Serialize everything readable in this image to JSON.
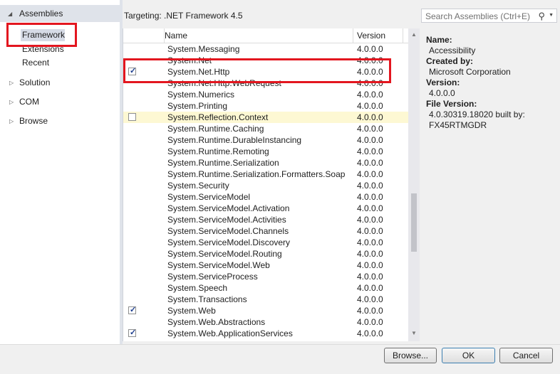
{
  "sidebar": {
    "header": "Assemblies",
    "items": [
      {
        "label": "Framework",
        "selected": true
      },
      {
        "label": "Extensions"
      },
      {
        "label": "Recent"
      }
    ],
    "groups": [
      "Solution",
      "COM",
      "Browse"
    ]
  },
  "targeting": "Targeting: .NET Framework 4.5",
  "search": {
    "placeholder": "Search Assemblies (Ctrl+E)"
  },
  "grid": {
    "columns": {
      "name": "Name",
      "version": "Version"
    },
    "rows": [
      {
        "name": "System.Messaging",
        "version": "4.0.0.0",
        "checkbox": false,
        "checked": false
      },
      {
        "name": "System.Net",
        "version": "4.0.0.0",
        "checkbox": false,
        "checked": false
      },
      {
        "name": "System.Net.Http",
        "version": "4.0.0.0",
        "checkbox": true,
        "checked": true
      },
      {
        "name": "System.Net.Http.WebRequest",
        "version": "4.0.0.0",
        "checkbox": false,
        "checked": false
      },
      {
        "name": "System.Numerics",
        "version": "4.0.0.0",
        "checkbox": false,
        "checked": false
      },
      {
        "name": "System.Printing",
        "version": "4.0.0.0",
        "checkbox": false,
        "checked": false
      },
      {
        "name": "System.Reflection.Context",
        "version": "4.0.0.0",
        "checkbox": true,
        "checked": false,
        "highlighted": true
      },
      {
        "name": "System.Runtime.Caching",
        "version": "4.0.0.0",
        "checkbox": false,
        "checked": false
      },
      {
        "name": "System.Runtime.DurableInstancing",
        "version": "4.0.0.0",
        "checkbox": false,
        "checked": false
      },
      {
        "name": "System.Runtime.Remoting",
        "version": "4.0.0.0",
        "checkbox": false,
        "checked": false
      },
      {
        "name": "System.Runtime.Serialization",
        "version": "4.0.0.0",
        "checkbox": false,
        "checked": false
      },
      {
        "name": "System.Runtime.Serialization.Formatters.Soap",
        "version": "4.0.0.0",
        "checkbox": false,
        "checked": false
      },
      {
        "name": "System.Security",
        "version": "4.0.0.0",
        "checkbox": false,
        "checked": false
      },
      {
        "name": "System.ServiceModel",
        "version": "4.0.0.0",
        "checkbox": false,
        "checked": false
      },
      {
        "name": "System.ServiceModel.Activation",
        "version": "4.0.0.0",
        "checkbox": false,
        "checked": false
      },
      {
        "name": "System.ServiceModel.Activities",
        "version": "4.0.0.0",
        "checkbox": false,
        "checked": false
      },
      {
        "name": "System.ServiceModel.Channels",
        "version": "4.0.0.0",
        "checkbox": false,
        "checked": false
      },
      {
        "name": "System.ServiceModel.Discovery",
        "version": "4.0.0.0",
        "checkbox": false,
        "checked": false
      },
      {
        "name": "System.ServiceModel.Routing",
        "version": "4.0.0.0",
        "checkbox": false,
        "checked": false
      },
      {
        "name": "System.ServiceModel.Web",
        "version": "4.0.0.0",
        "checkbox": false,
        "checked": false
      },
      {
        "name": "System.ServiceProcess",
        "version": "4.0.0.0",
        "checkbox": false,
        "checked": false
      },
      {
        "name": "System.Speech",
        "version": "4.0.0.0",
        "checkbox": false,
        "checked": false
      },
      {
        "name": "System.Transactions",
        "version": "4.0.0.0",
        "checkbox": false,
        "checked": false
      },
      {
        "name": "System.Web",
        "version": "4.0.0.0",
        "checkbox": true,
        "checked": true
      },
      {
        "name": "System.Web.Abstractions",
        "version": "4.0.0.0",
        "checkbox": false,
        "checked": false
      },
      {
        "name": "System.Web.ApplicationServices",
        "version": "4.0.0.0",
        "checkbox": true,
        "checked": true
      }
    ]
  },
  "details": [
    {
      "key": "Name:",
      "value": "Accessibility"
    },
    {
      "key": "Created by:",
      "value": "Microsoft Corporation"
    },
    {
      "key": "Version:",
      "value": "4.0.0.0"
    },
    {
      "key": "File Version:",
      "value": "4.0.30319.18020 built by: FX45RTMGDR"
    }
  ],
  "buttons": {
    "browse": "Browse...",
    "ok": "OK",
    "cancel": "Cancel"
  },
  "colors": {
    "annotation": "#e3161f",
    "highlight_row": "#fdf8d3",
    "check": "#1c3d8e"
  },
  "icons": {
    "search": "search-icon",
    "expand": "triangle-right-icon",
    "collapse": "triangle-down-icon"
  }
}
